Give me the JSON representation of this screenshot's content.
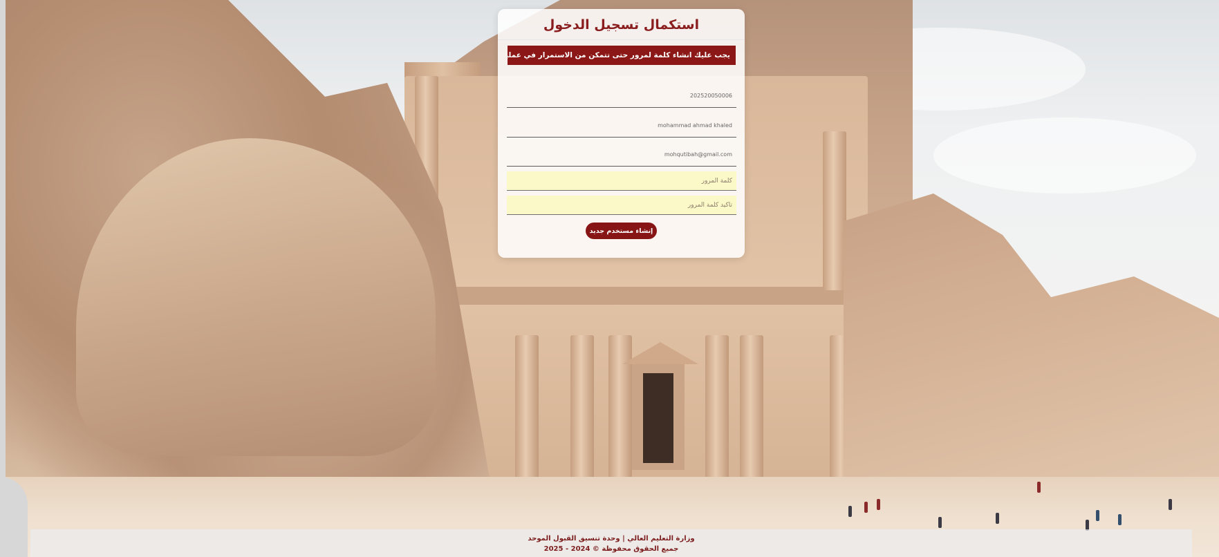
{
  "card": {
    "title": "استكمال تسجيل الدخول",
    "alert_text": "يجب عليك انشاء كلمة لمرور حتى تتمكن من الاستمرار في عملية التسجيل",
    "fields": {
      "id_number": "202520050006",
      "full_name": "mohammad ahmad khaled",
      "email": "mohqutibah@gmail.com",
      "password_placeholder": "كلمة المرور",
      "password_required_mark": "*",
      "confirm_password_placeholder": "تأكيد كلمة المرور",
      "confirm_required_mark": "*"
    },
    "submit_label": "إنشاء مستخدم جديد"
  },
  "footer": {
    "line1": "وزارة التعليم العالي | وحدة تنسيق القبول الموحد",
    "line2": "جميع الحقوق محفوظة © 2024 - 2025"
  },
  "colors": {
    "accent": "#871515",
    "title": "#8a1d1d",
    "password_field_bg": "#fbf9c8"
  }
}
